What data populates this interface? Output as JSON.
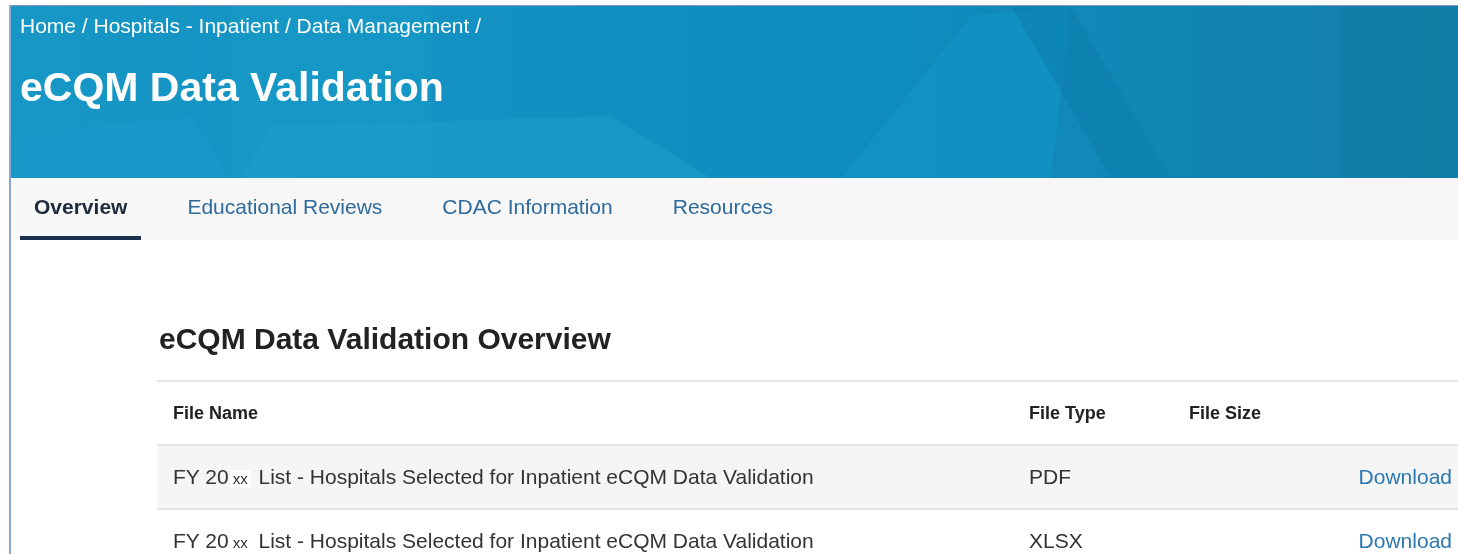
{
  "header": {
    "breadcrumb": "Home / Hospitals - Inpatient / Data Management /",
    "title": "eCQM Data Validation"
  },
  "tabs": [
    {
      "label": "Overview",
      "selected": true
    },
    {
      "label": "Educational Reviews",
      "selected": false
    },
    {
      "label": "CDAC Information",
      "selected": false
    },
    {
      "label": "Resources",
      "selected": false
    }
  ],
  "section": {
    "heading": "eCQM Data Validation Overview"
  },
  "table": {
    "columns": [
      "File Name",
      "File Type",
      "File Size"
    ],
    "rows": [
      {
        "file_name": {
          "prefix": "FY 20",
          "year": "xx",
          "rest": "List - Hospitals Selected for Inpatient eCQM Data Validation"
        },
        "file_type": "PDF",
        "action": "Download"
      },
      {
        "file_name": {
          "prefix": "FY 20",
          "year": "xx",
          "rest": "List - Hospitals Selected for Inpatient eCQM Data Validation"
        },
        "file_type": "XLSX",
        "action": "Download"
      }
    ]
  }
}
